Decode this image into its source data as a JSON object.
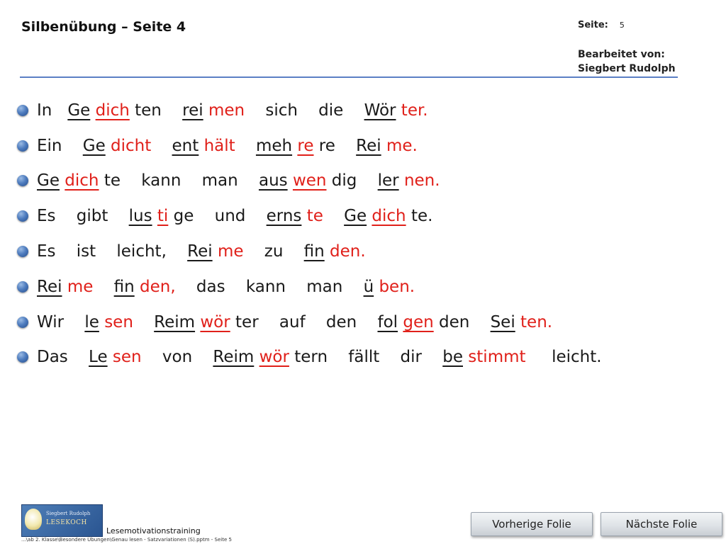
{
  "header": {
    "title": "Silbenübung – Seite 4",
    "page_label": "Seite:",
    "page_number": "5",
    "edited_by_label": "Bearbeitet von:",
    "editor_name": "Siegbert Rudolph"
  },
  "lines": [
    [
      {
        "t": "In",
        "c": "k",
        "u": false
      },
      {
        "t": "   ",
        "c": "k",
        "u": false
      },
      {
        "t": "Ge",
        "c": "k",
        "u": true
      },
      {
        "t": " ",
        "c": "k",
        "u": false
      },
      {
        "t": "dich",
        "c": "r",
        "u": true
      },
      {
        "t": " ten    ",
        "c": "k",
        "u": false
      },
      {
        "t": "rei",
        "c": "k",
        "u": true
      },
      {
        "t": " ",
        "c": "k",
        "u": false
      },
      {
        "t": "men",
        "c": "r",
        "u": false
      },
      {
        "t": "    sich    die    ",
        "c": "k",
        "u": false
      },
      {
        "t": "Wör",
        "c": "k",
        "u": true
      },
      {
        "t": " ",
        "c": "k",
        "u": false
      },
      {
        "t": "ter.",
        "c": "r",
        "u": false
      }
    ],
    [
      {
        "t": "Ein",
        "c": "k",
        "u": false
      },
      {
        "t": "    ",
        "c": "k",
        "u": false
      },
      {
        "t": "Ge",
        "c": "k",
        "u": true
      },
      {
        "t": " ",
        "c": "k",
        "u": false
      },
      {
        "t": "dicht",
        "c": "r",
        "u": false
      },
      {
        "t": "    ",
        "c": "k",
        "u": false
      },
      {
        "t": "ent",
        "c": "k",
        "u": true
      },
      {
        "t": " ",
        "c": "k",
        "u": false
      },
      {
        "t": "hält",
        "c": "r",
        "u": false
      },
      {
        "t": "    ",
        "c": "k",
        "u": false
      },
      {
        "t": "meh",
        "c": "k",
        "u": true
      },
      {
        "t": " ",
        "c": "k",
        "u": false
      },
      {
        "t": "re",
        "c": "r",
        "u": true
      },
      {
        "t": " re    ",
        "c": "k",
        "u": false
      },
      {
        "t": "Rei",
        "c": "k",
        "u": true
      },
      {
        "t": " ",
        "c": "k",
        "u": false
      },
      {
        "t": "me.",
        "c": "r",
        "u": false
      }
    ],
    [
      {
        "t": "Ge",
        "c": "k",
        "u": true
      },
      {
        "t": " ",
        "c": "k",
        "u": false
      },
      {
        "t": "dich",
        "c": "r",
        "u": true
      },
      {
        "t": " te    kann    man    ",
        "c": "k",
        "u": false
      },
      {
        "t": "aus",
        "c": "k",
        "u": true
      },
      {
        "t": " ",
        "c": "k",
        "u": false
      },
      {
        "t": "wen",
        "c": "r",
        "u": true
      },
      {
        "t": " dig    ",
        "c": "k",
        "u": false
      },
      {
        "t": "ler",
        "c": "k",
        "u": true
      },
      {
        "t": " ",
        "c": "k",
        "u": false
      },
      {
        "t": "nen.",
        "c": "r",
        "u": false
      }
    ],
    [
      {
        "t": "Es    gibt    ",
        "c": "k",
        "u": false
      },
      {
        "t": "lus",
        "c": "k",
        "u": true
      },
      {
        "t": " ",
        "c": "k",
        "u": false
      },
      {
        "t": "ti",
        "c": "r",
        "u": true
      },
      {
        "t": " ge    und    ",
        "c": "k",
        "u": false
      },
      {
        "t": "erns",
        "c": "k",
        "u": true
      },
      {
        "t": " ",
        "c": "k",
        "u": false
      },
      {
        "t": "te",
        "c": "r",
        "u": false
      },
      {
        "t": "    ",
        "c": "k",
        "u": false
      },
      {
        "t": "Ge",
        "c": "k",
        "u": true
      },
      {
        "t": " ",
        "c": "k",
        "u": false
      },
      {
        "t": "dich",
        "c": "r",
        "u": true
      },
      {
        "t": " te.",
        "c": "k",
        "u": false
      }
    ],
    [
      {
        "t": "Es    ist    leicht,    ",
        "c": "k",
        "u": false
      },
      {
        "t": "Rei",
        "c": "k",
        "u": true
      },
      {
        "t": " ",
        "c": "k",
        "u": false
      },
      {
        "t": "me",
        "c": "r",
        "u": false
      },
      {
        "t": "    zu    ",
        "c": "k",
        "u": false
      },
      {
        "t": "fin",
        "c": "k",
        "u": true
      },
      {
        "t": " ",
        "c": "k",
        "u": false
      },
      {
        "t": "den.",
        "c": "r",
        "u": false
      }
    ],
    [
      {
        "t": "Rei",
        "c": "k",
        "u": true
      },
      {
        "t": " ",
        "c": "k",
        "u": false
      },
      {
        "t": "me",
        "c": "r",
        "u": false
      },
      {
        "t": "    ",
        "c": "k",
        "u": false
      },
      {
        "t": "fin",
        "c": "k",
        "u": true
      },
      {
        "t": " ",
        "c": "k",
        "u": false
      },
      {
        "t": "den,",
        "c": "r",
        "u": false
      },
      {
        "t": "    das    kann    man    ",
        "c": "k",
        "u": false
      },
      {
        "t": "ü",
        "c": "k",
        "u": true
      },
      {
        "t": " ",
        "c": "k",
        "u": false
      },
      {
        "t": "ben.",
        "c": "r",
        "u": false
      }
    ],
    [
      {
        "t": "Wir    ",
        "c": "k",
        "u": false
      },
      {
        "t": "le",
        "c": "k",
        "u": true
      },
      {
        "t": " ",
        "c": "k",
        "u": false
      },
      {
        "t": "sen",
        "c": "r",
        "u": false
      },
      {
        "t": "    ",
        "c": "k",
        "u": false
      },
      {
        "t": "Reim",
        "c": "k",
        "u": true
      },
      {
        "t": " ",
        "c": "k",
        "u": false
      },
      {
        "t": "wör",
        "c": "r",
        "u": true
      },
      {
        "t": " ter    auf    den    ",
        "c": "k",
        "u": false
      },
      {
        "t": "fol",
        "c": "k",
        "u": true
      },
      {
        "t": " ",
        "c": "k",
        "u": false
      },
      {
        "t": "gen",
        "c": "r",
        "u": true
      },
      {
        "t": " den    ",
        "c": "k",
        "u": false
      },
      {
        "t": "Sei",
        "c": "k",
        "u": true
      },
      {
        "t": " ",
        "c": "k",
        "u": false
      },
      {
        "t": "ten.",
        "c": "r",
        "u": false
      }
    ],
    [
      {
        "t": "Das    ",
        "c": "k",
        "u": false
      },
      {
        "t": "Le",
        "c": "k",
        "u": true
      },
      {
        "t": " ",
        "c": "k",
        "u": false
      },
      {
        "t": "sen",
        "c": "r",
        "u": false
      },
      {
        "t": "    von    ",
        "c": "k",
        "u": false
      },
      {
        "t": "Reim",
        "c": "k",
        "u": true
      },
      {
        "t": " ",
        "c": "k",
        "u": false
      },
      {
        "t": "wör",
        "c": "r",
        "u": true
      },
      {
        "t": " tern    fällt    dir    ",
        "c": "k",
        "u": false
      },
      {
        "t": "be",
        "c": "k",
        "u": true
      },
      {
        "t": " ",
        "c": "k",
        "u": false
      },
      {
        "t": "stimmt",
        "c": "r",
        "u": false
      },
      {
        "t": "     leicht.",
        "c": "k",
        "u": false
      }
    ]
  ],
  "colors": {
    "k": "#1a1a1a",
    "r": "#e0201a",
    "accent": "#5b7fc4"
  },
  "footer": {
    "logo_name": "Siegbert Rudolph",
    "logo_brand": "LESEKOCH",
    "caption": "Lesemotivationstraining",
    "path": "...\\ab 2. Klasse\\Besondere Übungen\\Genau lesen - Satzvariationen (S).pptm - Seite 5",
    "prev_button": "Vorherige Folie",
    "next_button": "Nächste Folie"
  }
}
